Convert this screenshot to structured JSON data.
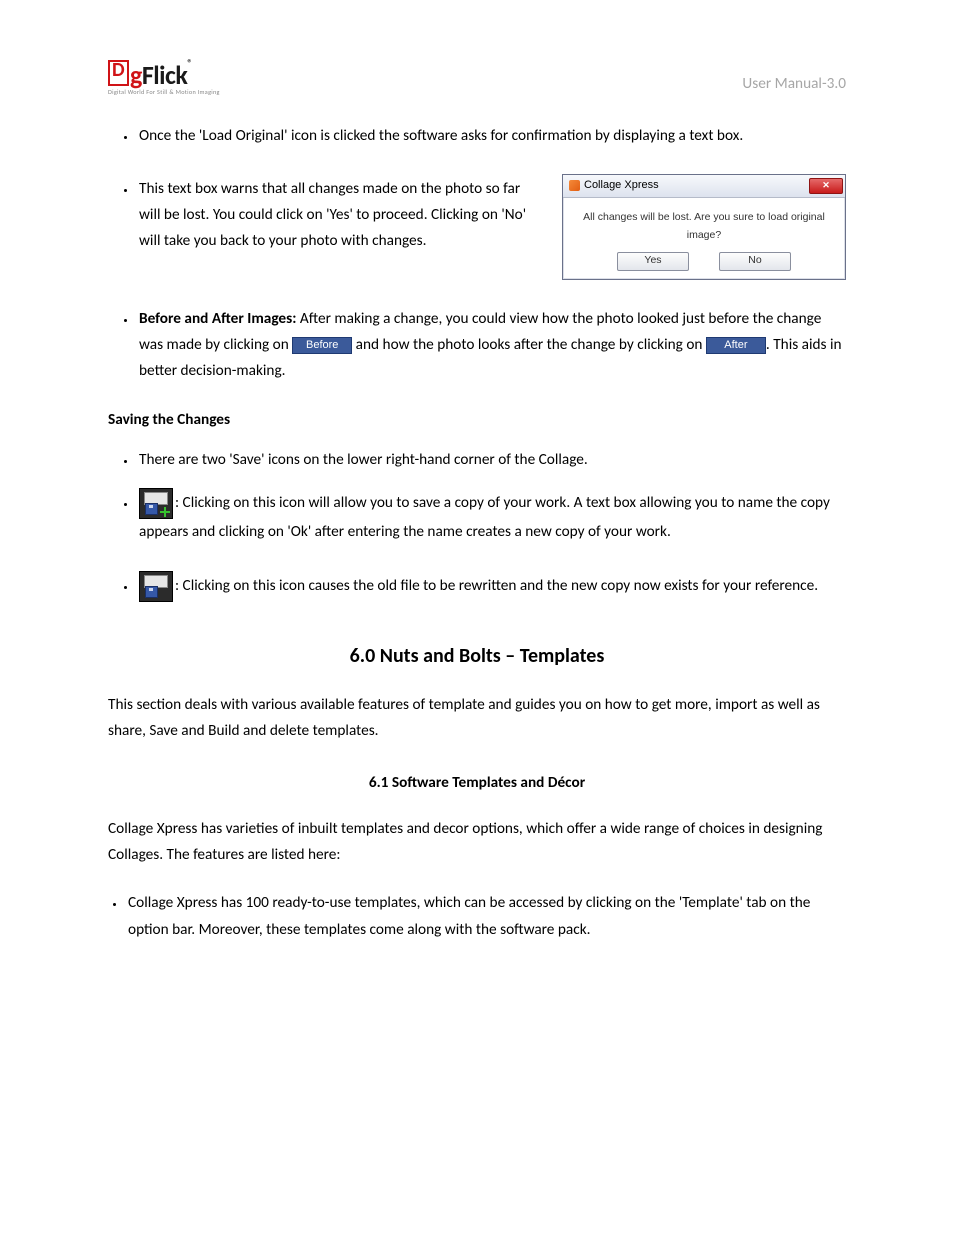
{
  "header": {
    "brand_d": "D",
    "brand_g": "g",
    "brand_rest": "Flick",
    "brand_reg": "®",
    "tagline": "Digital World For Still & Motion Imaging",
    "version": "User Manual-3.0"
  },
  "bullets1": {
    "b0": "Once the 'Load Original' icon is clicked the software asks for confirmation by displaying a text box.",
    "b1": "This text box warns that all changes made on the photo so far will be lost. You could click on 'Yes' to proceed. Clicking on 'No' will take you back to your photo with changes.",
    "b2_lead": "Before and After Images:",
    "b2_a": " After making a change, you could view how the photo looked just before the change was made by clicking on ",
    "b2_b": " and how the photo looks after the change by clicking on ",
    "b2_c": ". This aids in better decision-making.",
    "before_label": "Before",
    "after_label": "After"
  },
  "dialog": {
    "title": "Collage Xpress",
    "close_glyph": "✕",
    "message": "All changes will be lost. Are you sure to load original image?",
    "yes": "Yes",
    "no": "No"
  },
  "saving": {
    "heading": "Saving the Changes",
    "b0": "There are two 'Save' icons on the lower right-hand corner of the Collage.",
    "b1": ": Clicking on this icon will allow you to save a copy of your work. A text box allowing you to name the copy appears and clicking on 'Ok' after entering the name creates a new copy of your work.",
    "b2": ": Clicking on this icon causes the old file to be rewritten and the new copy now exists for your reference."
  },
  "section6": {
    "title": "6.0 Nuts and Bolts – Templates",
    "intro": "This section deals with various available features of template and guides you on how to get more, import as well as share, Save and Build and delete templates.",
    "sub_title": "6.1 Software Templates and Décor",
    "sub_intro": "Collage Xpress has varieties of inbuilt templates and decor options, which offer a wide range of choices in designing Collages. The features are listed here:",
    "b0": "Collage Xpress has 100 ready-to-use templates, which can be accessed by clicking on the 'Template' tab on the option bar. Moreover, these templates come along with the software pack."
  }
}
